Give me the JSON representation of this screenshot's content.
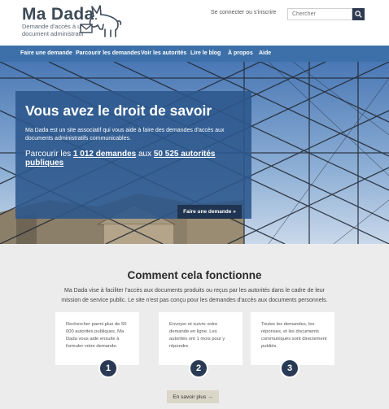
{
  "header": {
    "logo_title": "Ma Dada",
    "logo_tagline": "Demande d'accès à un document administratif",
    "login_link": "Se connecter ou s'inscrire",
    "search_placeholder": "Chercher"
  },
  "nav": {
    "items": [
      {
        "label": "Faire une demande"
      },
      {
        "label": "Parcourir les demandes"
      },
      {
        "label": "Voir les autorités"
      },
      {
        "label": "Lire le blog"
      },
      {
        "label": "À propos"
      },
      {
        "label": "Aide"
      }
    ]
  },
  "hero": {
    "title": "Vous avez le droit de savoir",
    "text": "Ma Dada est un site associatif qui vous aide à faire des demandes d'accès aux documents administratifs communicables.",
    "stats_prefix": "Parcourir les",
    "requests_count": "1 012 demandes",
    "stats_middle": "aux",
    "authorities_count": "50 525 autorités publiques",
    "cta": "Faire une demande »"
  },
  "how": {
    "title": "Comment cela fonctionne",
    "text": "Ma Dada vise à faciliter l'accès aux documents produits ou reçus par les autorités dans le cadre de leur mission de service public. Le site n'est pas conçu pour les demandes d'accès aux documents personnels.",
    "cards": [
      {
        "text": "Rechercher parmi plus de 50 000 autorités publiques, Ma Dada vous aide ensuite à formuler votre demande.",
        "step": "1"
      },
      {
        "text": "Envoyer et suivre votre demande en ligne. Les autorités ont 1 mois pour y répondre.",
        "step": "2"
      },
      {
        "text": "Toutes les demandes, les réponses, et les documents communiqués sont directement publiés.",
        "step": "3"
      }
    ],
    "more_button": "En savoir plus →"
  },
  "colors": {
    "nav_bg": "#3d70a8",
    "hero_panel": "#2b568c",
    "cta_bg": "#1f3450",
    "step_bg": "#2a3a55",
    "section_bg": "#ececec"
  }
}
